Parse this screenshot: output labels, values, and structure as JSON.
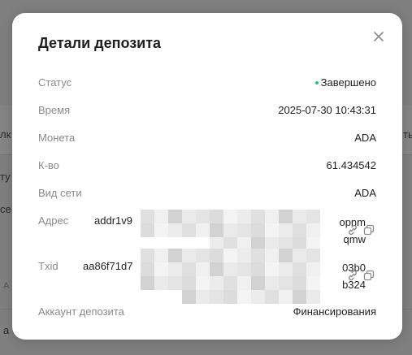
{
  "background": {
    "fragments": [
      "лк",
      "ть",
      "ту",
      "се",
      "А",
      "а"
    ]
  },
  "modal": {
    "title": "Детали депозита",
    "close_icon": "close-icon",
    "rows": {
      "status": {
        "label": "Статус",
        "value": "Завершено",
        "status_color": "#2ebd85"
      },
      "time": {
        "label": "Время",
        "value": "2025-07-30 10:43:31"
      },
      "coin": {
        "label": "Монета",
        "value": "ADA"
      },
      "qty": {
        "label": "К-во",
        "value": "61.434542"
      },
      "network": {
        "label": "Вид сети",
        "value": "ADA"
      },
      "address": {
        "label": "Адрес",
        "value_start": "addr1v9",
        "value_end_line1": "opnm",
        "value_end_line2": "qmw",
        "link_icon": "link-icon",
        "copy_icon": "copy-icon"
      },
      "txid": {
        "label": "Txid",
        "value_start": "aa86f71d7",
        "value_end_line1": "03b0",
        "value_end_line2": "b324",
        "link_icon": "link-icon",
        "copy_icon": "copy-icon"
      },
      "account": {
        "label": "Аккаунт депозита",
        "value": "Финансирования"
      }
    }
  }
}
